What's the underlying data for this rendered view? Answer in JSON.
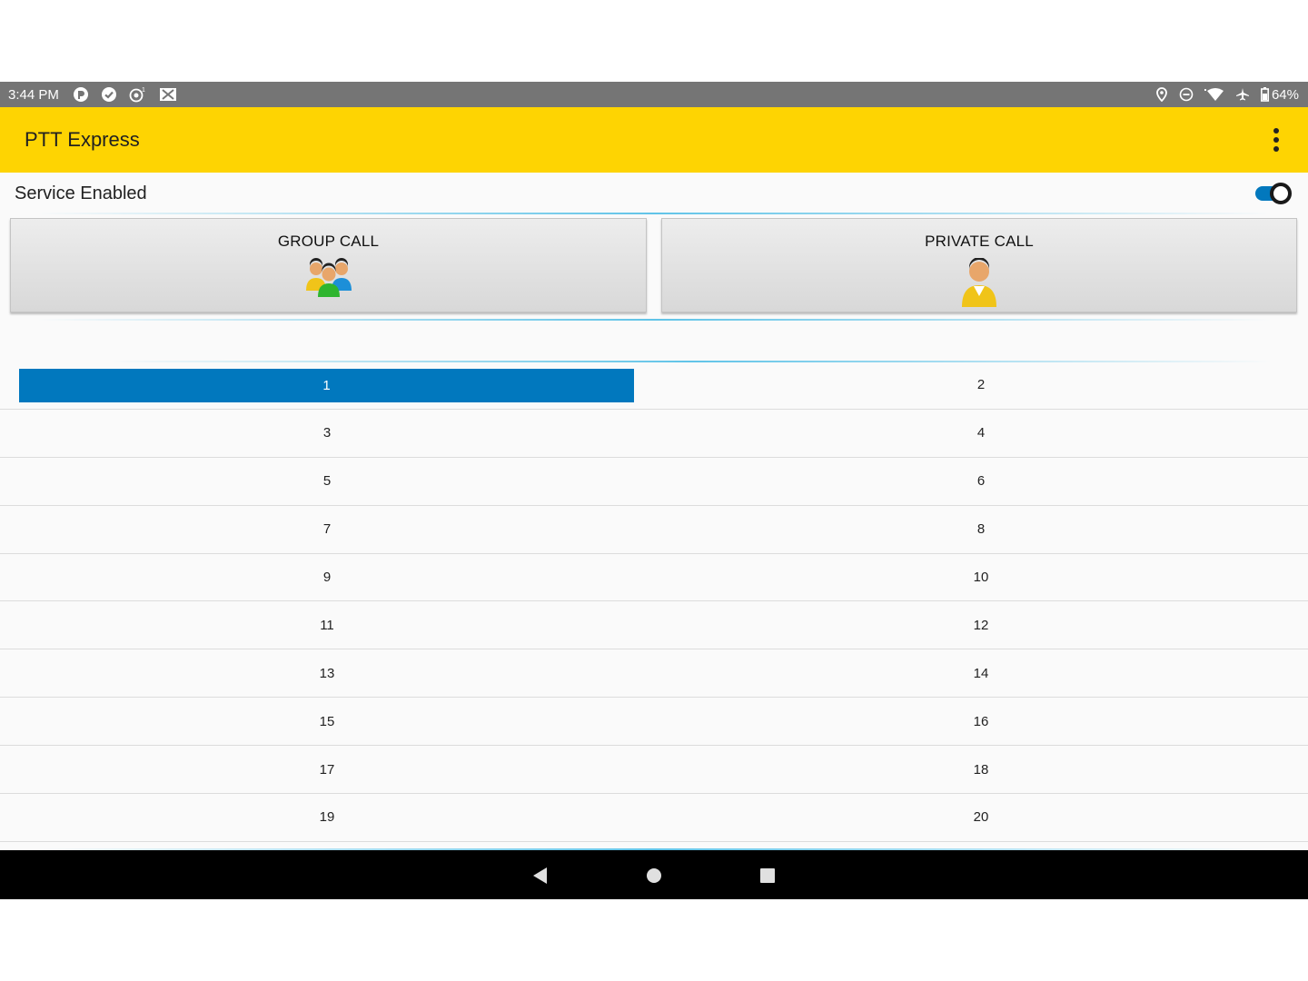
{
  "status_bar": {
    "time": "3:44 PM",
    "battery": "64%",
    "left_icons": [
      "whatsapp-like-icon",
      "check-circle-icon",
      "hotspot-icon",
      "no-image-icon"
    ],
    "right_icons": [
      "location-icon",
      "do-not-disturb-icon",
      "wifi-icon",
      "airplane-icon",
      "battery-icon"
    ]
  },
  "app_bar": {
    "title": "PTT Express",
    "background": "#fed402"
  },
  "service": {
    "label": "Service Enabled",
    "enabled": true,
    "accent": "#0278bd"
  },
  "buttons": {
    "group_call": "GROUP CALL",
    "private_call": "PRIVATE CALL"
  },
  "channels": {
    "selected": "1",
    "selected_color": "#0178be",
    "rows": [
      {
        "left": "1",
        "right": "2"
      },
      {
        "left": "3",
        "right": "4"
      },
      {
        "left": "5",
        "right": "6"
      },
      {
        "left": "7",
        "right": "8"
      },
      {
        "left": "9",
        "right": "10"
      },
      {
        "left": "11",
        "right": "12"
      },
      {
        "left": "13",
        "right": "14"
      },
      {
        "left": "15",
        "right": "16"
      },
      {
        "left": "17",
        "right": "18"
      },
      {
        "left": "19",
        "right": "20"
      }
    ]
  },
  "nav_bar": {
    "icons": [
      "back-icon",
      "home-icon",
      "recents-icon"
    ]
  }
}
